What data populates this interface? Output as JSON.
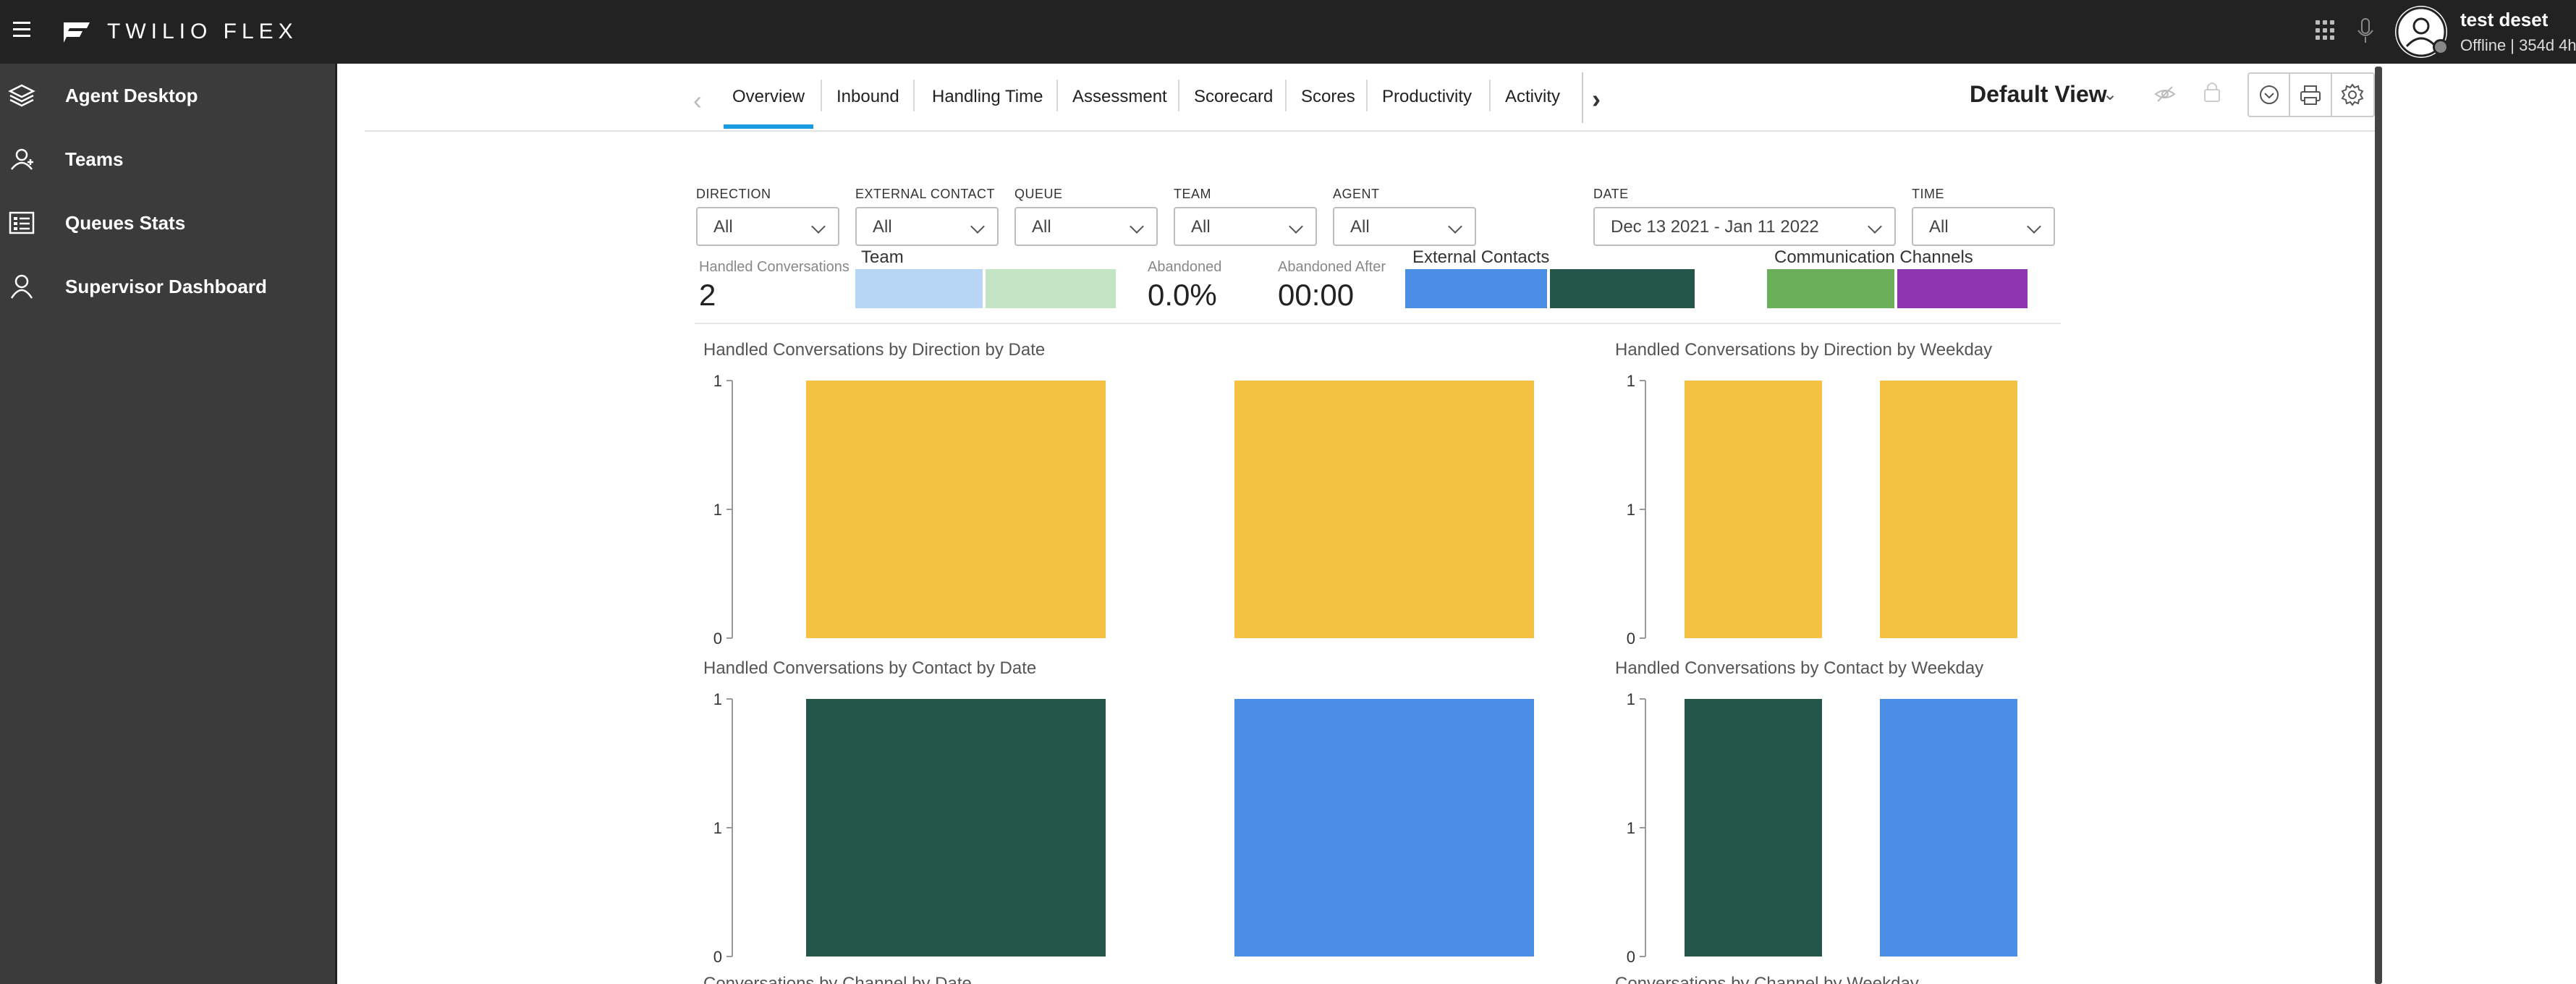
{
  "app": {
    "brand": "TWILIO FLEX"
  },
  "user": {
    "name": "test deset",
    "status": "Offline | 354d 4h"
  },
  "sidebar": {
    "items": [
      {
        "label": "Agent Desktop",
        "icon": "layers-icon"
      },
      {
        "label": "Teams",
        "icon": "team-icon"
      },
      {
        "label": "Queues Stats",
        "icon": "queue-list-icon"
      },
      {
        "label": "Supervisor Dashboard",
        "icon": "user-icon"
      }
    ]
  },
  "tabs": {
    "items": [
      "Overview",
      "Inbound",
      "Handling Time",
      "Assessment",
      "Scorecard",
      "Scores",
      "Productivity",
      "Activity"
    ],
    "active": "Overview",
    "prev_icon": "‹",
    "next_icon": "›"
  },
  "view": {
    "title": "Default View",
    "chevron": "⌄"
  },
  "filters": [
    {
      "label": "DIRECTION",
      "value": "All"
    },
    {
      "label": "EXTERNAL CONTACT",
      "value": "All"
    },
    {
      "label": "QUEUE",
      "value": "All"
    },
    {
      "label": "TEAM",
      "value": "All"
    },
    {
      "label": "AGENT",
      "value": "All"
    },
    {
      "label": "DATE",
      "value": "Dec 13 2021 - Jan 11 2022"
    },
    {
      "label": "TIME",
      "value": "All"
    }
  ],
  "kpis": {
    "handled_label": "Handled Conversations",
    "handled_value": "2",
    "team_label": "Team",
    "abandoned_label": "Abandoned",
    "abandoned_value": "0.0%",
    "abandoned_after_label": "Abandoned After",
    "abandoned_after_value": "00:00",
    "external_label": "External Contacts",
    "channels_label": "Communication Channels"
  },
  "colors": {
    "team": [
      "#b7d6f5",
      "#c4e5c4"
    ],
    "external": [
      "#4a8ee6",
      "#25564a"
    ],
    "channels": [
      "#6caf5a",
      "#8e35b0"
    ],
    "direction_bar": "#f4c243",
    "contact_dark": "#25564a",
    "contact_blue": "#4a8ee6"
  },
  "charts": [
    {
      "title": "Handled Conversations by Direction by Date"
    },
    {
      "title": "Handled Conversations by Direction by Weekday"
    },
    {
      "title": "Handled Conversations by Contact by Date"
    },
    {
      "title": "Handled Conversations by Contact by Weekday"
    },
    {
      "title": "Conversations by Channel by Date"
    },
    {
      "title": "Conversations by Channel by Weekday"
    }
  ],
  "chart_data": [
    {
      "type": "bar",
      "title": "Handled Conversations by Direction by Date",
      "categories": [
        "",
        ""
      ],
      "values": [
        1,
        1
      ],
      "colors": [
        "#f4c243",
        "#f4c243"
      ],
      "y_ticks": [
        "1",
        "1",
        "0"
      ],
      "ylim": [
        0,
        1
      ]
    },
    {
      "type": "bar",
      "title": "Handled Conversations by Direction by Weekday",
      "categories": [
        "",
        ""
      ],
      "values": [
        1,
        1
      ],
      "colors": [
        "#f4c243",
        "#f4c243"
      ],
      "y_ticks": [
        "1",
        "1",
        "0"
      ],
      "ylim": [
        0,
        1
      ]
    },
    {
      "type": "bar",
      "title": "Handled Conversations by Contact by Date",
      "categories": [
        "",
        ""
      ],
      "values": [
        1,
        1
      ],
      "colors": [
        "#25564a",
        "#4a8ee6"
      ],
      "y_ticks": [
        "1",
        "1",
        "0"
      ],
      "ylim": [
        0,
        1
      ]
    },
    {
      "type": "bar",
      "title": "Handled Conversations by Contact by Weekday",
      "categories": [
        "",
        ""
      ],
      "values": [
        1,
        1
      ],
      "colors": [
        "#25564a",
        "#4a8ee6"
      ],
      "y_ticks": [
        "1",
        "1",
        "0"
      ],
      "ylim": [
        0,
        1
      ]
    }
  ]
}
